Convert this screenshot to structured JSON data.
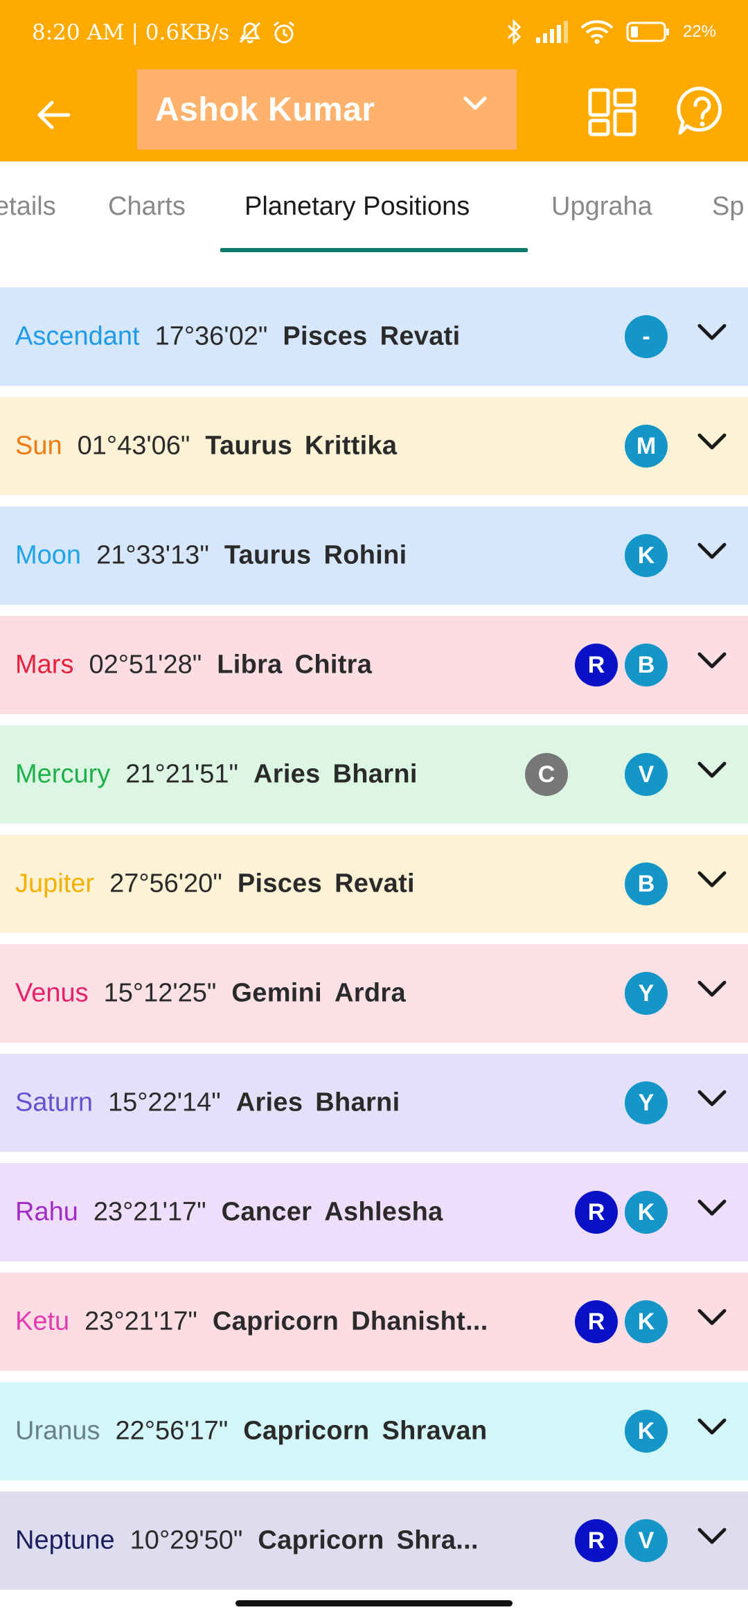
{
  "status_bar": {
    "time_speed": "8:20 AM | 0.6KB/s",
    "battery": "22%"
  },
  "app_bar": {
    "profile_name": "Ashok Kumar"
  },
  "tabs": [
    {
      "label": "etails",
      "active": false
    },
    {
      "label": "Charts",
      "active": false
    },
    {
      "label": "Planetary Positions",
      "active": true
    },
    {
      "label": "Upgraha",
      "active": false
    },
    {
      "label": "Sp",
      "active": false
    }
  ],
  "colors": {
    "app_bar": "#FFAA00",
    "profile_select": "#FFB26B",
    "tab_indicator": "#0F7A6C",
    "badge_blue": "#1497C8",
    "badge_navy": "#0A12C8",
    "badge_gray": "#777777"
  },
  "rows": [
    {
      "planet": "Ascendant",
      "degree": "17°36'02\"",
      "sign": "Pisces",
      "nakshatra": "Revati",
      "planet_color": "#1E9BE8",
      "bg": "#D6E6FB",
      "badges": [
        {
          "text": "-",
          "color": "#1497C8"
        }
      ]
    },
    {
      "planet": "Sun",
      "degree": "01°43'06\"",
      "sign": "Taurus",
      "nakshatra": "Krittika",
      "planet_color": "#F07A10",
      "bg": "#FDF2D6",
      "badges": [
        {
          "text": "M",
          "color": "#1497C8"
        }
      ]
    },
    {
      "planet": "Moon",
      "degree": "21°33'13\"",
      "sign": "Taurus",
      "nakshatra": "Rohini",
      "planet_color": "#1EA4E8",
      "bg": "#D6E6FB",
      "badges": [
        {
          "text": "K",
          "color": "#1497C8"
        }
      ]
    },
    {
      "planet": "Mars",
      "degree": "02°51'28\"",
      "sign": "Libra",
      "nakshatra": "Chitra",
      "planet_color": "#E8203A",
      "bg": "#FBDDE3",
      "badges": [
        {
          "text": "R",
          "color": "#0A12C8"
        },
        {
          "text": "B",
          "color": "#1497C8"
        }
      ]
    },
    {
      "planet": "Mercury",
      "degree": "21°21'51\"",
      "sign": "Aries",
      "nakshatra": "Bharni",
      "planet_color": "#1EB04A",
      "bg": "#DDF6E3",
      "badges": [
        {
          "text": "C",
          "color": "#777777"
        },
        {
          "text": "V",
          "color": "#1497C8"
        }
      ]
    },
    {
      "planet": "Jupiter",
      "degree": "27°56'20\"",
      "sign": "Pisces",
      "nakshatra": "Revati",
      "planet_color": "#F5B100",
      "bg": "#FDF2D6",
      "badges": [
        {
          "text": "B",
          "color": "#1497C8"
        }
      ]
    },
    {
      "planet": "Venus",
      "degree": "15°12'25\"",
      "sign": "Gemini",
      "nakshatra": "Ardra",
      "planet_color": "#E8206A",
      "bg": "#FBE0E6",
      "badges": [
        {
          "text": "Y",
          "color": "#1497C8"
        }
      ]
    },
    {
      "planet": "Saturn",
      "degree": "15°22'14\"",
      "sign": "Aries",
      "nakshatra": "Bharni",
      "planet_color": "#6A4FD0",
      "bg": "#E3E0FA",
      "badges": [
        {
          "text": "Y",
          "color": "#1497C8"
        }
      ]
    },
    {
      "planet": "Rahu",
      "degree": "23°21'17\"",
      "sign": "Cancer",
      "nakshatra": "Ashlesha",
      "planet_color": "#A22BC8",
      "bg": "#EEDDFB",
      "badges": [
        {
          "text": "R",
          "color": "#0A12C8"
        },
        {
          "text": "K",
          "color": "#1497C8"
        }
      ]
    },
    {
      "planet": "Ketu",
      "degree": "23°21'17\"",
      "sign": "Capricorn",
      "nakshatra": "Dhanisht...",
      "planet_color": "#E23BB0",
      "bg": "#FBDDE3",
      "badges": [
        {
          "text": "R",
          "color": "#0A12C8"
        },
        {
          "text": "K",
          "color": "#1497C8"
        }
      ]
    },
    {
      "planet": "Uranus",
      "degree": "22°56'17\"",
      "sign": "Capricorn",
      "nakshatra": "Shravan",
      "planet_color": "#6A7F86",
      "bg": "#D3F7F8",
      "badges": [
        {
          "text": "K",
          "color": "#1497C8"
        }
      ]
    },
    {
      "planet": "Neptune",
      "degree": "10°29'50\"",
      "sign": "Capricorn",
      "nakshatra": "Shra...",
      "planet_color": "#1B1E5E",
      "bg": "#DEDDF0",
      "badges": [
        {
          "text": "R",
          "color": "#0A12C8"
        },
        {
          "text": "V",
          "color": "#1497C8"
        }
      ]
    }
  ]
}
